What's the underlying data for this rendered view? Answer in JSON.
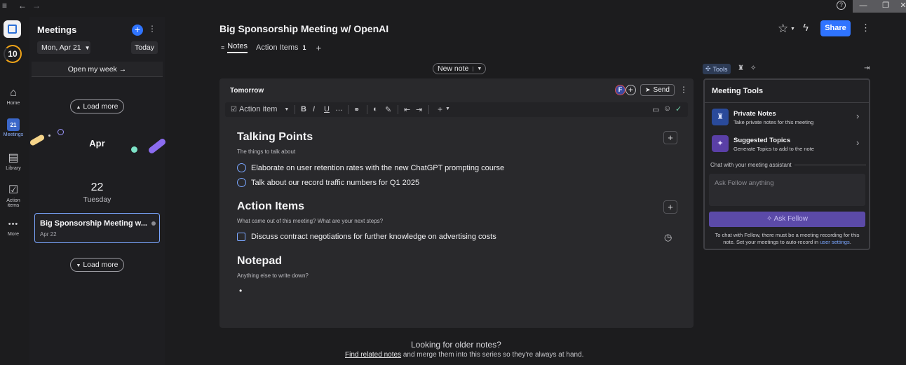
{
  "titlebar": {
    "menu_icon": "≡",
    "back_icon": "←",
    "fwd_icon": "→",
    "help_icon": "?",
    "min": "—",
    "restore": "❐",
    "close": "✕"
  },
  "rail": {
    "streak": "10",
    "items": [
      {
        "label": "Home",
        "icon": "⌂"
      },
      {
        "label": "Meetings",
        "icon": "21"
      },
      {
        "label": "Library",
        "icon": "▤"
      },
      {
        "label": "Action items",
        "icon": "☑"
      },
      {
        "label": "More",
        "icon": "•••"
      }
    ]
  },
  "meetings": {
    "title": "Meetings",
    "date_selector": "Mon, Apr 21",
    "today_label": "Today",
    "open_week": "Open my week",
    "load_more": "Load more",
    "month": "Apr",
    "day_number": "22",
    "day_name": "Tuesday",
    "meeting_card": {
      "title": "Big Sponsorship Meeting w...",
      "date": "Apr 22"
    }
  },
  "main": {
    "title": "Big Sponsorship Meeting w/ OpenAI",
    "share_label": "Share",
    "tabs": [
      {
        "label": "Notes"
      },
      {
        "label": "Action Items",
        "badge": "1"
      }
    ],
    "new_note": "New note",
    "note_header": {
      "title": "Tomorrow",
      "avatar": "F",
      "send": "Send"
    },
    "toolbar": {
      "block_type": "Action item"
    },
    "sections": {
      "talking": {
        "title": "Talking Points",
        "subtitle": "The things to talk about",
        "items": [
          "Elaborate on user retention rates with the new ChatGPT prompting course",
          "Talk about our record traffic numbers for Q1 2025"
        ]
      },
      "actions": {
        "title": "Action Items",
        "subtitle": "What came out of this meeting? What are your next steps?",
        "items": [
          "Discuss contract negotiations for further knowledge on advertising costs"
        ]
      },
      "notepad": {
        "title": "Notepad",
        "subtitle": "Anything else to write down?",
        "bullet": "•"
      }
    },
    "older": {
      "heading": "Looking for older notes?",
      "link": "Find related notes",
      "rest": " and merge them into this series so they're always at hand."
    }
  },
  "tools": {
    "tab_label": "Tools",
    "panel_title": "Meeting Tools",
    "private": {
      "title": "Private Notes",
      "desc": "Take private notes for this meeting"
    },
    "topics": {
      "title": "Suggested Topics",
      "desc": "Generate Topics to add to the note"
    },
    "chat_label": "Chat with your meeting assistant",
    "chat_placeholder": "Ask Fellow anything",
    "ask_button": "Ask Fellow",
    "footer_text": "To chat with Fellow, there must be a meeting recording for this note. Set your meetings to auto-record in ",
    "footer_link": "user settings",
    "footer_end": "."
  }
}
